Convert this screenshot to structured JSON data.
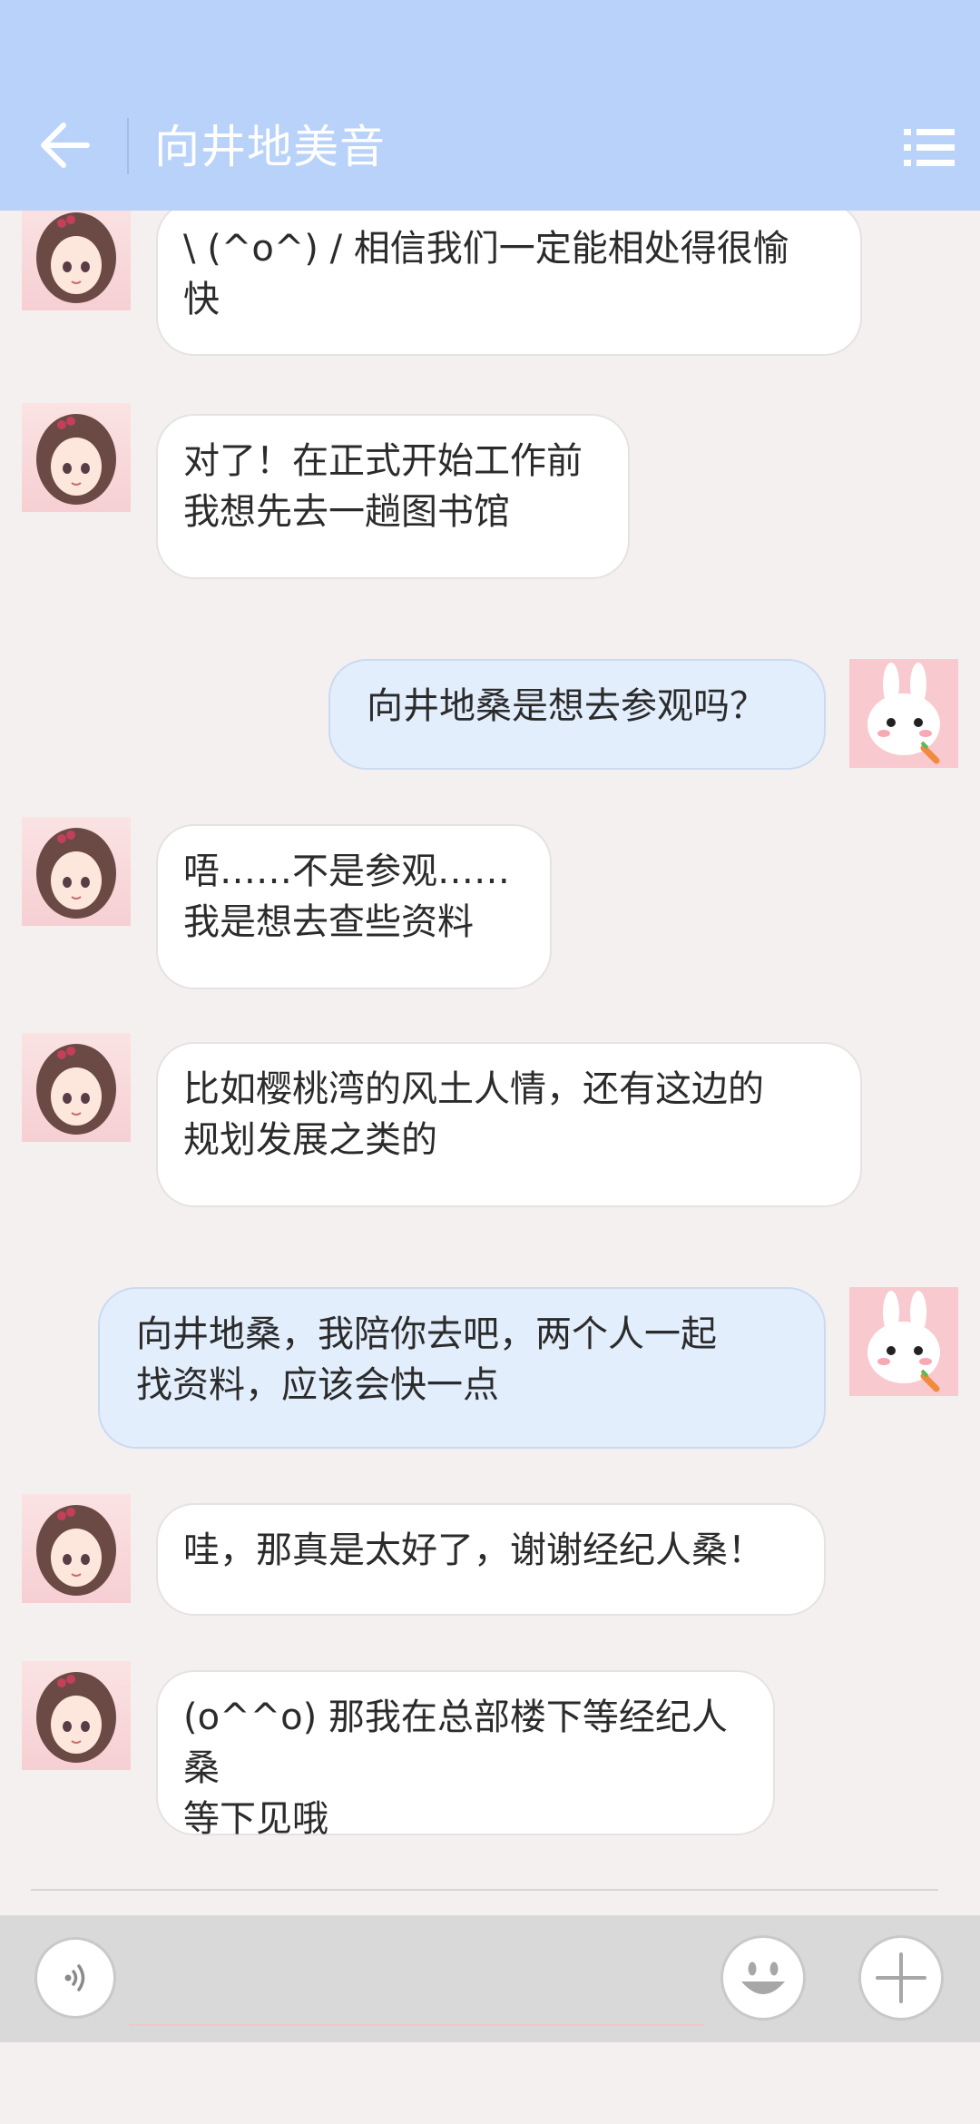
{
  "header": {
    "title": "向井地美音",
    "back_icon": "arrow-left-icon",
    "menu_icon": "list-icon",
    "background": "#b8d2fa"
  },
  "messages": [
    {
      "side": "left",
      "avatar": "girl-avatar",
      "text": "\\ (^o^) / 相信我们一定能相处得很愉\n快"
    },
    {
      "side": "left",
      "avatar": "girl-avatar",
      "text": "对了！在正式开始工作前\n我想先去一趟图书馆"
    },
    {
      "side": "right",
      "avatar": "bunny-avatar",
      "text": "向井地桑是想去参观吗？"
    },
    {
      "side": "left",
      "avatar": "girl-avatar",
      "text": "唔……不是参观……\n我是想去查些资料"
    },
    {
      "side": "left",
      "avatar": "girl-avatar",
      "text": "比如樱桃湾的风土人情，还有这边的\n规划发展之类的"
    },
    {
      "side": "right",
      "avatar": "bunny-avatar",
      "text": "向井地桑，我陪你去吧，两个人一起\n找资料，应该会快一点"
    },
    {
      "side": "left",
      "avatar": "girl-avatar",
      "text": "哇，那真是太好了，谢谢经纪人桑！"
    },
    {
      "side": "left",
      "avatar": "girl-avatar",
      "text": "(o^^o) 那我在总部楼下等经纪人桑\n等下见哦"
    }
  ],
  "composer": {
    "input_value": "",
    "voice_icon": "voice-icon",
    "emoji_icon": "emoji-icon",
    "plus_icon": "plus-icon"
  },
  "colors": {
    "incoming_bubble": "#ffffff",
    "outgoing_bubble": "#e3eefc",
    "chat_background": "#f5f0f0"
  }
}
